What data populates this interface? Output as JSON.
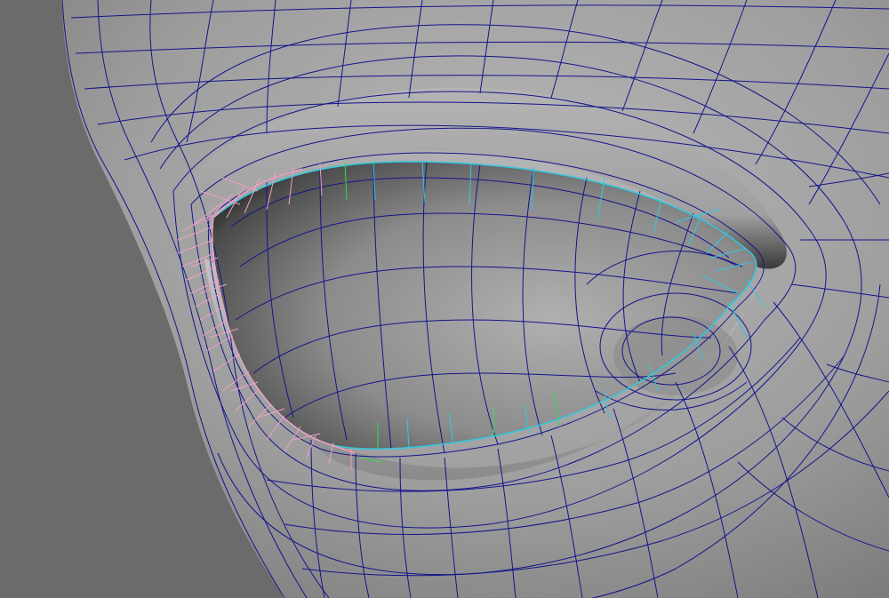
{
  "viewport": {
    "colors": {
      "background": "#6b6b6b",
      "wireframe": "#14148c",
      "eyelid_normals_pink": "#f0a0c0",
      "eyelid_normals_cyan": "#30c8e0",
      "eyelid_normals_green": "#30e050"
    }
  }
}
